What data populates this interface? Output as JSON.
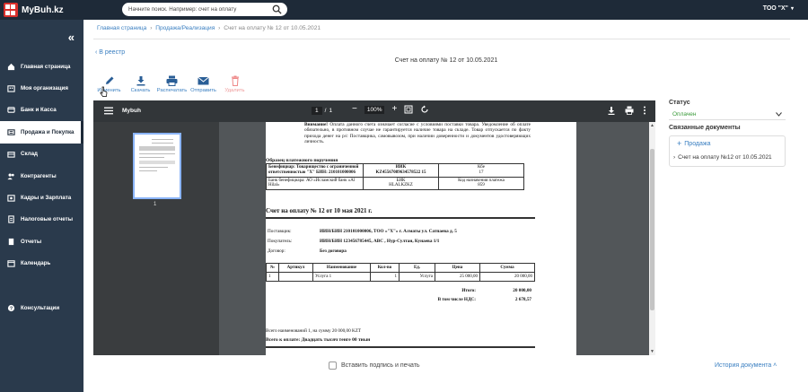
{
  "app": {
    "name": "MyBuh.kz"
  },
  "topbar": {
    "search_placeholder": "Начните поиск. Например: счет на оплату",
    "company": "ТОО \"Х\"",
    "company_chevron": "▾"
  },
  "sidebar": {
    "collapse": "«",
    "items": [
      {
        "label": "Главная страница",
        "icon": "home-icon",
        "active": false
      },
      {
        "label": "Моя организация",
        "icon": "organization-icon",
        "active": false
      },
      {
        "label": "Банк и Касса",
        "icon": "bank-icon",
        "active": false
      },
      {
        "label": "Продажа и Покупка",
        "icon": "cart-icon",
        "active": true
      },
      {
        "label": "Склад",
        "icon": "warehouse-icon",
        "active": false
      },
      {
        "label": "Контрагенты",
        "icon": "contacts-icon",
        "active": false
      },
      {
        "label": "Кадры и Зарплата",
        "icon": "payroll-icon",
        "active": false
      },
      {
        "label": "Налоговые отчеты",
        "icon": "tax-icon",
        "active": false
      },
      {
        "label": "Отчеты",
        "icon": "reports-icon",
        "active": false
      },
      {
        "label": "Календарь",
        "icon": "calendar-icon",
        "active": false
      },
      {
        "label": "Консультации",
        "icon": "help-icon",
        "active": false
      }
    ]
  },
  "breadcrumb": {
    "home": "Главная страница",
    "sales": "Продажа/Реализация",
    "current": "Счет на оплату № 12 от 10.05.2021",
    "separator": "›"
  },
  "back_link": "‹  В реестр",
  "doc_title": "Счет на оплату № 12 от 10.05.2021",
  "toolbar": {
    "edit": "Изменить",
    "download": "Скачать",
    "print": "Распечатать",
    "send": "Отправить",
    "delete": "Удалить"
  },
  "viewer": {
    "title": "Mybuh",
    "page_current": "1",
    "page_sep": "/",
    "page_total": "1",
    "zoom": "100%",
    "zoom_out": "−",
    "zoom_in": "+",
    "thumb_number": "1"
  },
  "pdf": {
    "notice_bold": "Внимание!",
    "notice_text": " Оплата данного счета означает согласие с условиями поставки товара. Уведомление об оплате обязательно, в противном случае не гарантируется наличие товара на складе. Товар отпускается по факту прихода денег на р/с Поставщика, самовывозом, при наличии доверенности и документов удостоверяющих личность.",
    "sample_title": "Образец платежного поручения",
    "beneficiary": "Бенефициар: Товарищество с ограниченной ответственностью \"Х\" БИН: 210101000006",
    "iik_label": "ИИК",
    "iik_value": "KZ45567089634578522 15",
    "kbe_label": "Кбе",
    "kbe_value": "17",
    "bank": "Банк бенефициара: АО «Исламский банк «Al Hilal»",
    "bik_label": "БИК",
    "bik_value": "HLALKZKZ",
    "knp_label": "Код назначения платежа",
    "knp_value": "859",
    "invoice_title": "Счет на оплату № 12 от 10 мая 2021 г.",
    "supplier_label": "Поставщик:",
    "supplier_value": "ИИН/БИН 210101000006, ТОО «\"Х\"» г. Алматы ул. Сатпаева д. 5",
    "buyer_label": "Покупатель:",
    "buyer_value": "ИИН/БИН 123456785445, ABC , Нур-Султан, Кунаева 1/1",
    "contract_label": "Договор:",
    "contract_value": "Без договора",
    "columns": [
      "№",
      "Артикул",
      "Наименование",
      "Кол-во",
      "Ед.",
      "Цена",
      "Сумма"
    ],
    "rows": [
      [
        "1",
        "",
        "Услуга 1",
        "1",
        "Услуга",
        "25 000,00",
        "20 000,00"
      ]
    ],
    "total_label": "Итого:",
    "total_value": "20 000,00",
    "vat_label": "В том числе НДС:",
    "vat_value": "2 678,57",
    "summary": "Всего наименований 1, на сумму 20 000,00 KZT",
    "summary_words": "Всего к оплате: Двадцать тысяч тенге 00 тиын"
  },
  "footer": {
    "sign_label": "Вставить подпись и печать",
    "history": "История документа ˄"
  },
  "right_panel": {
    "status_label": "Статус",
    "status_value": "Оплачен",
    "status_color": "#3a9a3a",
    "related_label": "Связанные документы",
    "add_label": "Продажа",
    "related_doc": "Счет на оплату №12 от 10.05.2021"
  }
}
